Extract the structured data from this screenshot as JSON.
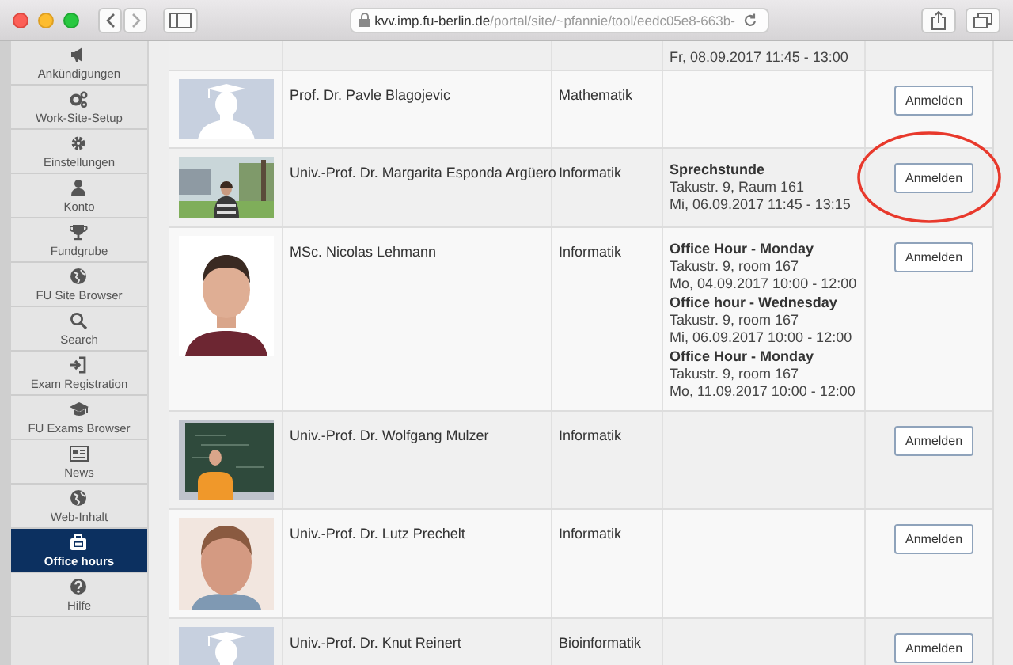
{
  "browser": {
    "url": "**kvv.imp.fu-berlin.de**/portal/site/~pfannie/tool/eedc05e8-663b-"
  },
  "sidebar": {
    "items": [
      {
        "label": "Ankündigungen",
        "selected": false
      },
      {
        "label": "Work-Site-Setup",
        "selected": false
      },
      {
        "label": "Einstellungen",
        "selected": false
      },
      {
        "label": "Konto",
        "selected": false
      },
      {
        "label": "Fundgrube",
        "selected": false
      },
      {
        "label": "FU Site Browser",
        "selected": false
      },
      {
        "label": "Search",
        "selected": false
      },
      {
        "label": "Exam Registration",
        "selected": false
      },
      {
        "label": "FU Exams Browser",
        "selected": false
      },
      {
        "label": "News",
        "selected": false
      },
      {
        "label": "Web-Inhalt",
        "selected": false
      },
      {
        "label": "Office hours",
        "selected": true
      },
      {
        "label": "Hilfe",
        "selected": false
      }
    ]
  },
  "table": {
    "partial_row": {
      "time": "Fr, 08.09.2017 11:45 - 13:00"
    },
    "rows": [
      {
        "photo": {
          "kind": "placeholder"
        },
        "name": "Prof. Dr. Pavle Blagojevic",
        "department": "Mathematik",
        "slots": [],
        "button": "Anmelden",
        "highlighted": false
      },
      {
        "photo": {
          "kind": "picture"
        },
        "name": "Univ.-Prof. Dr. Margarita Esponda Argüero",
        "department": "Informatik",
        "slots": [
          {
            "title": "Sprechstunde",
            "location": "Takustr. 9, Raum 161",
            "time": "Mi, 06.09.2017 11:45 - 13:15"
          }
        ],
        "button": "Anmelden",
        "highlighted": true
      },
      {
        "photo": {
          "kind": "picture"
        },
        "name": "MSc. Nicolas Lehmann",
        "department": "Informatik",
        "slots": [
          {
            "title": "Office Hour - Monday",
            "location": "Takustr. 9, room 167",
            "time": "Mo, 04.09.2017 10:00 - 12:00"
          },
          {
            "title": "Office hour - Wednesday",
            "location": "Takustr. 9, room 167",
            "time": "Mi, 06.09.2017 10:00 - 12:00"
          },
          {
            "title": "Office Hour - Monday",
            "location": "Takustr. 9, room 167",
            "time": "Mo, 11.09.2017 10:00 - 12:00"
          }
        ],
        "button": "Anmelden",
        "highlighted": false
      },
      {
        "photo": {
          "kind": "picture"
        },
        "name": "Univ.-Prof. Dr. Wolfgang Mulzer",
        "department": "Informatik",
        "slots": [],
        "button": "Anmelden",
        "highlighted": false
      },
      {
        "photo": {
          "kind": "picture"
        },
        "name": "Univ.-Prof. Dr. Lutz Prechelt",
        "department": "Informatik",
        "slots": [],
        "button": "Anmelden",
        "highlighted": false
      },
      {
        "photo": {
          "kind": "placeholder"
        },
        "name": "Univ.-Prof. Dr. Knut Reinert",
        "department": "Bioinformatik",
        "slots": [],
        "button": "Anmelden",
        "highlighted": false
      }
    ]
  }
}
